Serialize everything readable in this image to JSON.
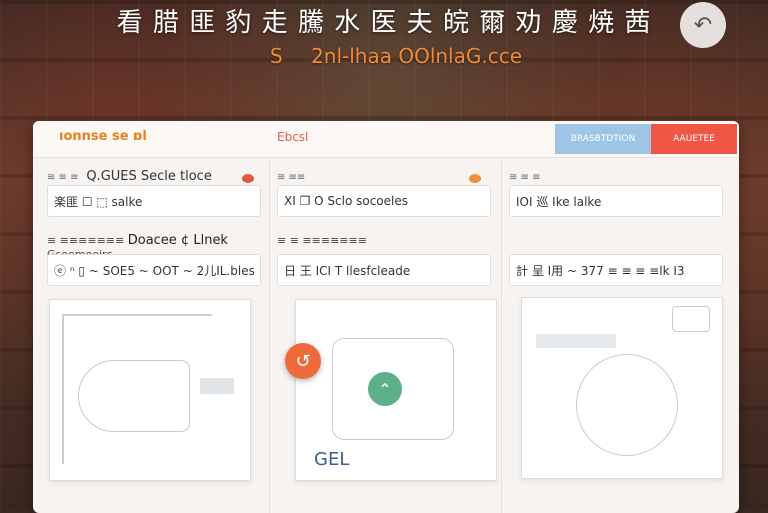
{
  "banner": {
    "headline": "看 腊 匪 豹 走 騰 水 医 夫 皖 爾 劝 慶 焼 茜",
    "sub_s": "S",
    "sub_rest": "2nl-lhaa OOlnlaG.cce"
  },
  "app": {
    "title": "ıonnse se ɒl",
    "tab_label": "Ebcsl",
    "buttons": {
      "primary": "BRASBTDTION",
      "danger": "AAUETEE"
    }
  },
  "columns": [
    {
      "small": "≋ ≡ ≡",
      "header": "Q.GUES Secle tloce",
      "field1": "楽匪 ☐ ⬚ salke",
      "section_small": "≡ ≡≡≡≡≡≡≡",
      "section": "Doacee ¢ Llnek",
      "section_suffix": "Gseemoeirc",
      "field2": "ⓔ ⁿ ▯ ~ SOE5 ~ OOT ~ 2儿IL.bles"
    },
    {
      "small": "≋ ≡≡",
      "header": "",
      "field1": "XI ❐ O Sclo socoeles",
      "section_small": "≡ ≡ ≡≡≡≡≡≡≡",
      "section": "",
      "field2": "日 王 ICI T llesfcleade",
      "preview_label": "GEL"
    },
    {
      "small": "≋ ≡ ≡",
      "header": "",
      "field1": "IOI 巡 Ike lalke",
      "field2": "計 呈 I用 ~ 377 ≡ ≡ ≡ ≡lk I3"
    }
  ],
  "colors": {
    "accent_orange": "#e8801e",
    "danger": "#ee5645",
    "primary": "#9ec5e6",
    "success": "#5bb08a"
  },
  "icons": [
    "back-arrow-icon",
    "refresh-icon",
    "upload-icon",
    "camera-icon",
    "folder-icon",
    "face-icon"
  ]
}
